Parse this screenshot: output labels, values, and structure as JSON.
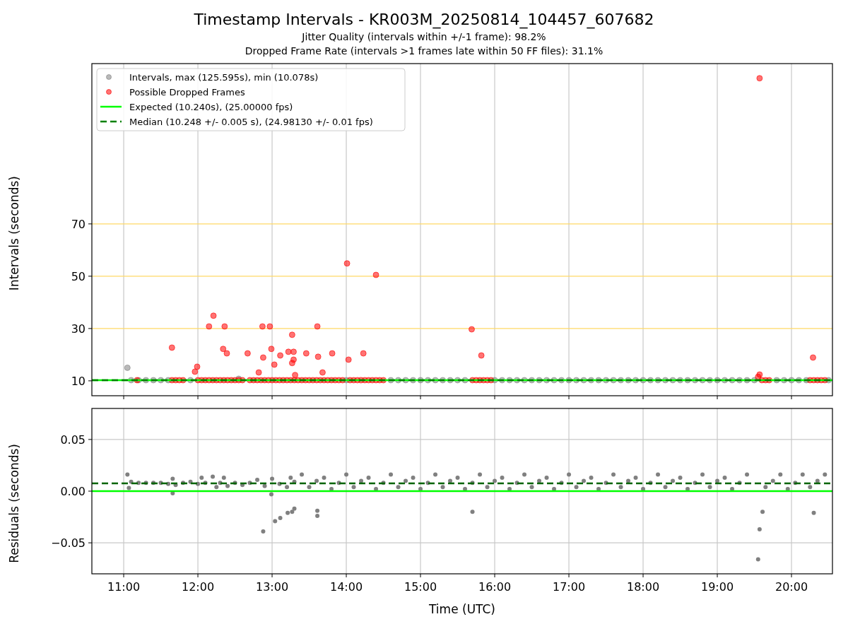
{
  "figure": {
    "title": "Timestamp Intervals - KR003M_20250814_104457_607682",
    "subtitles": [
      "Jitter Quality (intervals within +/-1 frame): 98.2%",
      "Dropped Frame Rate (intervals >1 frames late within 50 FF files): 31.1%"
    ]
  },
  "intervals_plot": {
    "chart_data": {
      "type": "scatter",
      "ylabel": "Intervals (seconds)",
      "xlim": [
        10.571,
        20.552
      ],
      "ylim": [
        4.3,
        131.3
      ],
      "grid": true,
      "legend": "upper left",
      "yticks": [
        {
          "value": 10,
          "label": "10"
        },
        {
          "value": 30,
          "label": "30"
        },
        {
          "value": 50,
          "label": "50"
        },
        {
          "value": 70,
          "label": "70"
        }
      ],
      "series": [
        {
          "name": "Intervals, max (125.595s), min (10.078s)",
          "color": "#808080",
          "x": [
            11.05,
            12.55,
            11.1,
            11.2,
            11.3,
            11.4,
            11.5,
            11.6,
            11.9,
            14.0,
            14.6,
            14.7,
            14.8,
            14.9,
            15.0,
            15.1,
            15.2,
            15.3,
            15.4,
            15.5,
            15.6,
            16.0,
            16.1,
            16.2,
            16.3,
            16.4,
            16.5,
            16.6,
            16.7,
            16.8,
            16.9,
            17.0,
            17.1,
            17.2,
            17.3,
            17.4,
            17.5,
            17.6,
            17.7,
            17.8,
            17.9,
            18.0,
            18.1,
            18.2,
            18.3,
            18.4,
            18.5,
            18.6,
            18.7,
            18.8,
            18.9,
            19.0,
            19.1,
            19.2,
            19.3,
            19.4,
            19.5,
            19.8,
            19.9,
            20.0,
            20.1,
            20.2,
            20.5
          ],
          "values": [
            15.0,
            10.8,
            10.25,
            10.25,
            10.25,
            10.25,
            10.25,
            10.25,
            10.25,
            10.25,
            10.25,
            10.25,
            10.25,
            10.25,
            10.25,
            10.25,
            10.25,
            10.25,
            10.25,
            10.25,
            10.25,
            10.25,
            10.25,
            10.25,
            10.25,
            10.25,
            10.25,
            10.25,
            10.25,
            10.25,
            10.25,
            10.25,
            10.25,
            10.25,
            10.25,
            10.25,
            10.25,
            10.25,
            10.25,
            10.25,
            10.25,
            10.25,
            10.25,
            10.25,
            10.25,
            10.25,
            10.25,
            10.25,
            10.25,
            10.25,
            10.25,
            10.25,
            10.25,
            10.25,
            10.25,
            10.25,
            10.25,
            10.25,
            10.25,
            10.25,
            10.25,
            10.25,
            10.25
          ]
        },
        {
          "name": "Possible Dropped Frames",
          "color": "#ff0000",
          "x": [
            11.65,
            11.99,
            11.96,
            12.15,
            12.21,
            12.36,
            12.34,
            12.39,
            12.67,
            12.82,
            12.87,
            12.88,
            12.97,
            12.99,
            13.03,
            13.11,
            13.22,
            13.29,
            13.27,
            13.27,
            13.29,
            13.31,
            13.46,
            13.61,
            13.62,
            13.68,
            13.81,
            14.01,
            14.03,
            14.23,
            14.4,
            15.69,
            15.82,
            19.57,
            19.57,
            20.29,
            11.18,
            11.65,
            11.7,
            11.75,
            11.8,
            12.0,
            12.05,
            12.1,
            12.15,
            12.2,
            12.25,
            12.3,
            12.35,
            12.4,
            12.45,
            12.5,
            12.55,
            12.6,
            12.7,
            12.75,
            12.8,
            12.85,
            12.9,
            12.95,
            13.0,
            13.05,
            13.1,
            13.15,
            13.2,
            13.25,
            13.3,
            13.35,
            13.4,
            13.45,
            13.5,
            13.55,
            13.6,
            13.65,
            13.7,
            13.75,
            13.8,
            13.85,
            13.9,
            13.95,
            14.05,
            14.1,
            14.15,
            14.2,
            14.25,
            14.3,
            14.35,
            14.4,
            14.45,
            14.5,
            15.7,
            15.75,
            15.8,
            15.85,
            15.9,
            15.95,
            19.55,
            19.6,
            19.65,
            19.7,
            20.25,
            20.3,
            20.35,
            20.4,
            20.45
          ],
          "values": [
            22.7,
            15.4,
            13.5,
            30.8,
            34.9,
            30.8,
            22.2,
            20.5,
            20.5,
            13.2,
            30.8,
            18.9,
            30.8,
            22.2,
            16.2,
            19.7,
            21.1,
            21.1,
            27.6,
            16.8,
            18.1,
            12.2,
            20.5,
            30.8,
            19.2,
            13.2,
            20.5,
            54.9,
            18.1,
            20.5,
            50.5,
            29.7,
            19.7,
            125.7,
            12.4,
            18.9,
            10.25,
            10.25,
            10.25,
            10.25,
            10.25,
            10.25,
            10.25,
            10.25,
            10.25,
            10.25,
            10.25,
            10.25,
            10.25,
            10.25,
            10.25,
            10.25,
            10.25,
            10.25,
            10.25,
            10.25,
            10.25,
            10.25,
            10.25,
            10.25,
            10.25,
            10.25,
            10.25,
            10.25,
            10.25,
            10.25,
            10.25,
            10.25,
            10.25,
            10.25,
            10.25,
            10.25,
            10.25,
            10.25,
            10.25,
            10.25,
            10.25,
            10.25,
            10.25,
            10.25,
            10.25,
            10.25,
            10.25,
            10.25,
            10.25,
            10.25,
            10.25,
            10.25,
            10.25,
            10.25,
            10.25,
            10.25,
            10.25,
            10.25,
            10.25,
            10.25,
            11.5,
            10.25,
            10.25,
            10.25,
            10.25,
            10.25,
            10.25,
            10.25,
            10.25
          ]
        },
        {
          "name": "Expected (10.240s), (25.00000 fps)",
          "color": "#00ff00",
          "type": "line",
          "line_style": "solid",
          "x": [
            10.571,
            20.552
          ],
          "values": [
            10.24,
            10.24
          ]
        },
        {
          "name": "Median (10.248 +/- 0.005 s), (24.98130 +/- 0.01 fps)",
          "color": "#008000",
          "type": "line",
          "line_style": "dashed",
          "x": [
            10.571,
            20.552
          ],
          "values": [
            10.248,
            10.248
          ]
        }
      ]
    }
  },
  "residuals_plot": {
    "chart_data": {
      "type": "scatter",
      "xlabel": "Time (UTC)",
      "ylabel": "Residuals (seconds)",
      "xlim": [
        10.571,
        20.552
      ],
      "ylim": [
        -0.08,
        0.08
      ],
      "grid": true,
      "xticks": [
        {
          "value": 11,
          "label": "11:00"
        },
        {
          "value": 12,
          "label": "12:00"
        },
        {
          "value": 13,
          "label": "13:00"
        },
        {
          "value": 14,
          "label": "14:00"
        },
        {
          "value": 15,
          "label": "15:00"
        },
        {
          "value": 16,
          "label": "16:00"
        },
        {
          "value": 17,
          "label": "17:00"
        },
        {
          "value": 18,
          "label": "18:00"
        },
        {
          "value": 19,
          "label": "19:00"
        },
        {
          "value": 20,
          "label": "20:00"
        }
      ],
      "yticks": [
        {
          "value": -0.05,
          "label": "−0.05"
        },
        {
          "value": 0,
          "label": "0.00"
        },
        {
          "value": 0.05,
          "label": "0.05"
        }
      ],
      "series": [
        {
          "color": "#808080",
          "x": [
            11.05,
            11.07,
            11.1,
            11.2,
            11.3,
            11.4,
            11.5,
            11.6,
            11.66,
            11.66,
            11.7,
            11.8,
            11.9,
            12.0,
            12.05,
            12.1,
            12.2,
            12.25,
            12.3,
            12.35,
            12.4,
            12.5,
            12.6,
            12.7,
            12.8,
            12.9,
            12.99,
            13.0,
            13.1,
            13.2,
            13.25,
            13.3,
            12.88,
            13.04,
            13.11,
            13.21,
            13.27,
            13.3,
            13.61,
            13.61,
            15.7,
            19.61,
            19.57,
            19.55,
            20.3,
            13.4,
            13.5,
            13.6,
            13.7,
            13.8,
            13.9,
            14.0,
            14.1,
            14.2,
            14.3,
            14.4,
            14.5,
            14.6,
            14.7,
            14.8,
            14.9,
            15.0,
            15.1,
            15.2,
            15.3,
            15.4,
            15.5,
            15.6,
            15.7,
            15.8,
            15.9,
            16.0,
            16.1,
            16.2,
            16.3,
            16.4,
            16.5,
            16.6,
            16.7,
            16.8,
            16.9,
            17.0,
            17.1,
            17.2,
            17.3,
            17.4,
            17.5,
            17.6,
            17.7,
            17.8,
            17.9,
            18.0,
            18.1,
            18.2,
            18.3,
            18.4,
            18.5,
            18.6,
            18.7,
            18.8,
            18.9,
            19.0,
            19.1,
            19.2,
            19.3,
            19.4,
            19.65,
            19.75,
            19.85,
            19.95,
            20.05,
            20.15,
            20.25,
            20.35,
            20.45
          ],
          "values": [
            0.016,
            0.003,
            0.009,
            0.008,
            0.008,
            0.008,
            0.008,
            0.007,
            0.012,
            -0.002,
            0.006,
            0.008,
            0.009,
            0.007,
            0.013,
            0.008,
            0.014,
            0.004,
            0.008,
            0.013,
            0.005,
            0.008,
            0.006,
            0.008,
            0.011,
            0.005,
            -0.003,
            0.012,
            0.007,
            0.004,
            0.013,
            0.009,
            -0.039,
            -0.029,
            -0.026,
            -0.021,
            -0.02,
            -0.017,
            -0.019,
            -0.024,
            -0.02,
            -0.02,
            -0.037,
            -0.066,
            -0.021,
            0.016,
            0.004,
            0.01,
            0.013,
            0.002,
            0.008,
            0.016,
            0.004,
            0.01,
            0.013,
            0.002,
            0.008,
            0.016,
            0.004,
            0.01,
            0.013,
            0.002,
            0.008,
            0.016,
            0.004,
            0.01,
            0.013,
            0.002,
            0.008,
            0.016,
            0.004,
            0.01,
            0.013,
            0.002,
            0.008,
            0.016,
            0.004,
            0.01,
            0.013,
            0.002,
            0.008,
            0.016,
            0.004,
            0.01,
            0.013,
            0.002,
            0.008,
            0.016,
            0.004,
            0.01,
            0.013,
            0.002,
            0.008,
            0.016,
            0.004,
            0.01,
            0.013,
            0.002,
            0.008,
            0.016,
            0.004,
            0.01,
            0.013,
            0.002,
            0.008,
            0.016,
            0.004,
            0.01,
            0.016,
            0.002,
            0.008,
            0.016,
            0.004,
            0.01,
            0.016
          ]
        },
        {
          "color": "#00ff00",
          "type": "line",
          "line_style": "solid",
          "x": [
            10.571,
            20.552
          ],
          "values": [
            0,
            0
          ]
        },
        {
          "color": "#006400",
          "type": "line",
          "line_style": "dashed",
          "x": [
            10.571,
            20.552
          ],
          "values": [
            0.0075,
            0.0075
          ]
        }
      ]
    }
  }
}
